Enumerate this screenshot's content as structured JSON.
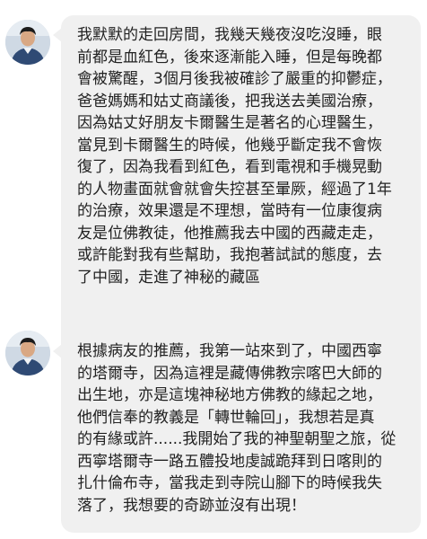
{
  "messages": [
    {
      "lines": [
        "我默默的走回房間，我幾天幾夜沒吃沒睡，眼",
        "前都是血紅色，後來逐漸能入睡，但是每晚都",
        "會被驚醒，3個月後我被確診了嚴重的抑鬱症，",
        "爸爸媽媽和姑丈商議後，把我送去美國治療，",
        "因為姑丈好朋友卡爾醫生是著名的心理醫生，",
        "當見到卡爾醫生的時候，他幾乎斷定我不會恢",
        "復了，因為我看到紅色，看到電視和手機晃動",
        "的人物畫面就會就會失控甚至暈厥，經過了1年",
        "的治療，效果還是不理想，當時有一位康復病",
        "友是位佛教徒，他推薦我去中國的西藏走走，",
        "或許能對我有些幫助，我抱著試試的態度，去",
        "了中國，走進了神秘的藏區"
      ]
    },
    {
      "lines": [
        "根據病友的推薦，我第一站來到了，中國西寧",
        "的塔爾寺，因為這裡是藏傳佛教宗喀巴大師的",
        "出生地，亦是這塊神秘地方佛教的緣起之地，",
        "他們信奉的教義是「轉世輪回」，我想若是真",
        "的有緣或許......我開始了我的神聖朝聖之旅，從",
        "西寧塔爾寺一路五體投地虔誠跪拜到日喀則的",
        "扎什倫布寺，當我走到寺院山腳下的時候我失",
        "落了，我想要的奇跡並沒有出現！"
      ]
    }
  ]
}
